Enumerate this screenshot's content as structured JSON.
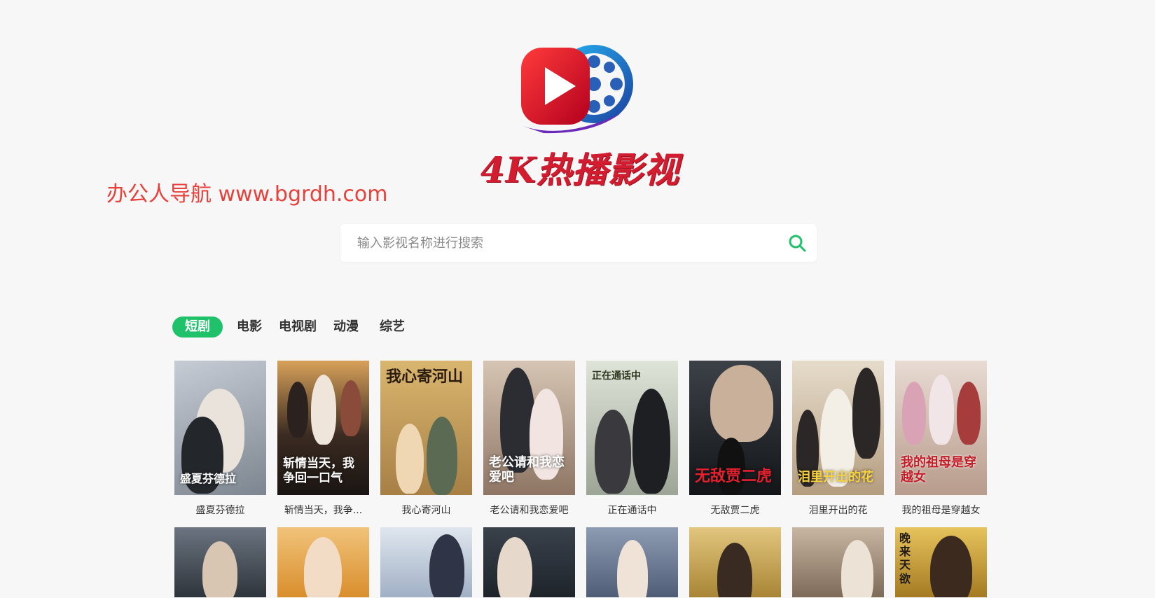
{
  "watermark": "办公人导航 www.bgrdh.com",
  "brand": {
    "name": "4K热播影视",
    "logo_icon": "play-film-reel-logo"
  },
  "search": {
    "placeholder": "输入影视名称进行搜索",
    "value": "",
    "icon": "search-icon",
    "accent": "#1fc16b"
  },
  "tabs": [
    {
      "label": "短剧",
      "active": true
    },
    {
      "label": "电影",
      "active": false
    },
    {
      "label": "电视剧",
      "active": false
    },
    {
      "label": "动漫",
      "active": false
    },
    {
      "label": "综艺",
      "active": false
    }
  ],
  "row1": [
    {
      "title": "盛夏芬德拉",
      "poster_text": "盛夏芬德拉",
      "bg": "#9aa3ad"
    },
    {
      "title": "斩情当天，我争...",
      "poster_text": "斩情当天，我争回一口气",
      "bg": "#5a4a3f"
    },
    {
      "title": "我心寄河山",
      "poster_text": "我心寄河山",
      "bg": "#c9a56a"
    },
    {
      "title": "老公请和我恋爱吧",
      "poster_text": "老公请和我恋爱吧",
      "bg": "#b79a82"
    },
    {
      "title": "正在通话中",
      "poster_text": "正在通话中",
      "bg": "#aeb7a6"
    },
    {
      "title": "无敌贾二虎",
      "poster_text": "无敌贾二虎",
      "bg": "#2b3036"
    },
    {
      "title": "泪里开出的花",
      "poster_text": "泪里开出的花",
      "bg": "#c8b79c"
    },
    {
      "title": "我的祖母是穿越女",
      "poster_text": "我的祖母是穿越女",
      "bg": "#c9b4a8"
    }
  ],
  "row2": [
    {
      "bg": "#4a5560"
    },
    {
      "bg": "#d9a055"
    },
    {
      "bg": "#b9c4d4"
    },
    {
      "bg": "#48515c"
    },
    {
      "bg": "#6c7c95"
    },
    {
      "bg": "#bfa35a"
    },
    {
      "bg": "#9e8a78"
    },
    {
      "bg": "#d2a849",
      "poster_text": "晚来天欲"
    }
  ]
}
